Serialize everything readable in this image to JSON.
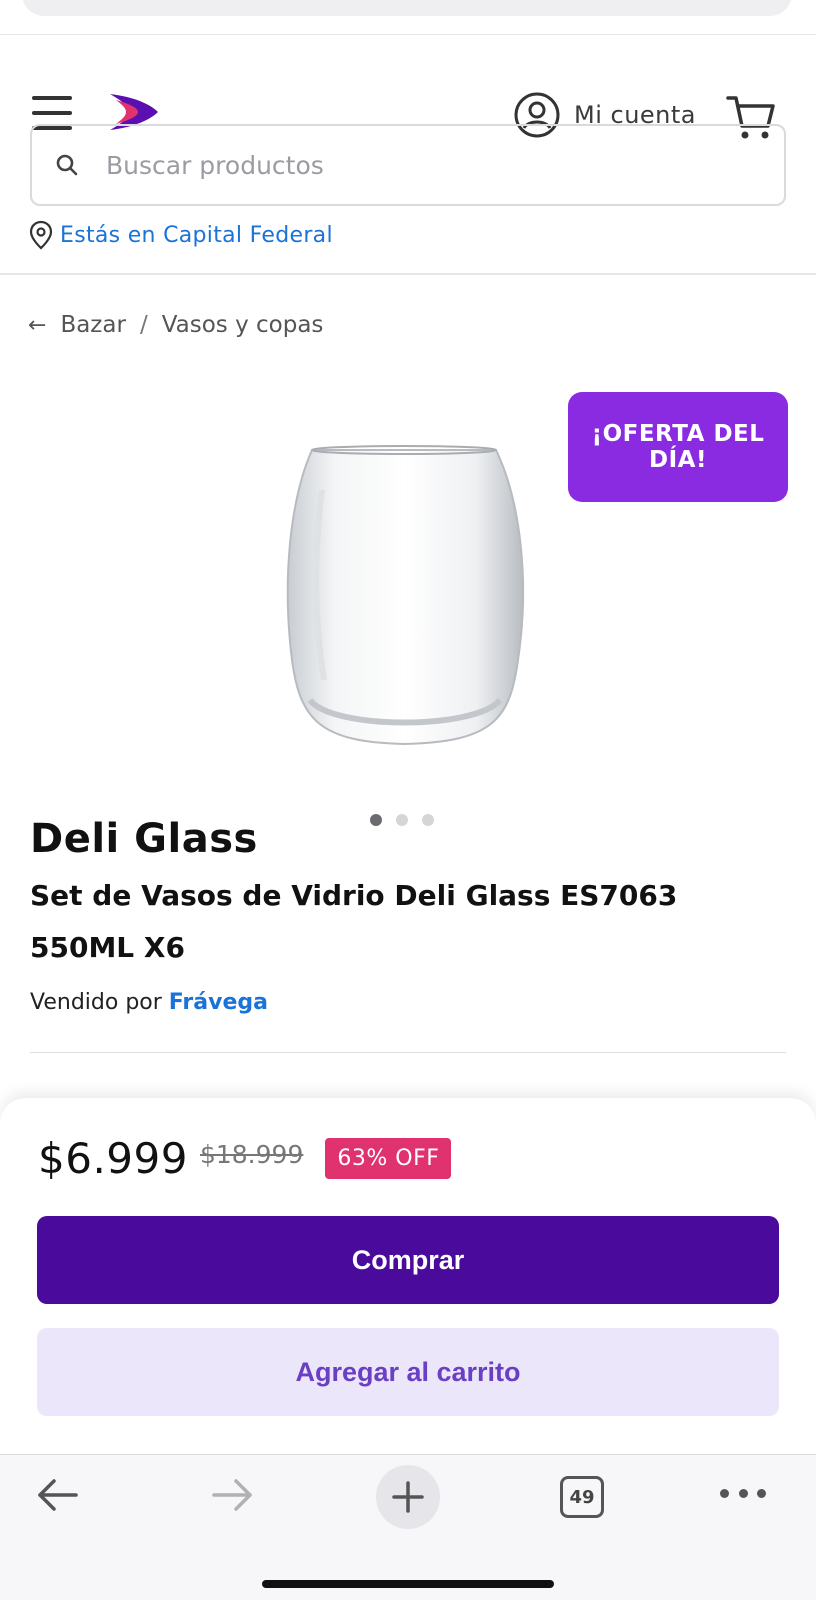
{
  "header": {
    "account_label": "Mi cuenta",
    "search_placeholder": "Buscar productos",
    "location_label": "Estás en Capital Federal",
    "brand_color": "#7b1fd9"
  },
  "breadcrumb": {
    "back_icon": "arrow-left-icon",
    "items": [
      "Bazar",
      "Vasos y copas"
    ],
    "separator": "/"
  },
  "product": {
    "deal_badge": "¡OFERTA DEL DÍA!",
    "brand": "Deli Glass",
    "title": "Set de Vasos de Vidrio Deli Glass ES7063 550ML X6",
    "seller_prefix": "Vendido por",
    "seller_name": "Frávega",
    "image_count": 3,
    "active_image": 1
  },
  "purchase": {
    "price": "$6.999",
    "old_price": "$18.999",
    "discount": "63% OFF",
    "buy_label": "Comprar",
    "add_to_cart_label": "Agregar al carrito",
    "accent_color": "#4a0a9c",
    "discount_color": "#e0326e"
  },
  "browser": {
    "tab_count": "49"
  }
}
